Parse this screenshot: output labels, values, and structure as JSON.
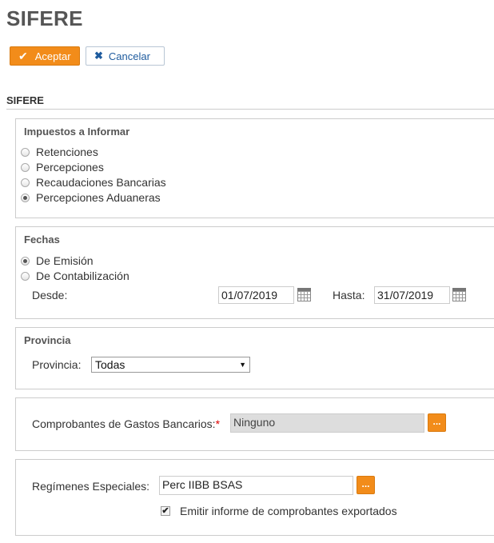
{
  "page": {
    "title": "SIFERE"
  },
  "toolbar": {
    "accept_label": "Aceptar",
    "cancel_label": "Cancelar"
  },
  "section": {
    "heading": "SIFERE"
  },
  "impuestos": {
    "title": "Impuestos a Informar",
    "options": [
      {
        "label": "Retenciones",
        "selected": false
      },
      {
        "label": "Percepciones",
        "selected": false
      },
      {
        "label": "Recaudaciones Bancarias",
        "selected": false
      },
      {
        "label": "Percepciones Aduaneras",
        "selected": true
      }
    ]
  },
  "fechas": {
    "title": "Fechas",
    "options": [
      {
        "label": "De Emisión",
        "selected": true
      },
      {
        "label": "De Contabilización",
        "selected": false
      }
    ],
    "desde_label": "Desde:",
    "desde_value": "01/07/2019",
    "hasta_label": "Hasta:",
    "hasta_value": "31/07/2019"
  },
  "provincia": {
    "title": "Provincia",
    "label": "Provincia:",
    "selected": "Todas"
  },
  "gastos": {
    "label": "Comprobantes de Gastos Bancarios:",
    "required_mark": "*",
    "value": "Ninguno",
    "button_label": "..."
  },
  "regimenes": {
    "label": "Regímenes Especiales:",
    "value": "Perc IIBB BSAS",
    "button_label": "...",
    "checkbox_label": "Emitir informe de comprobantes exportados",
    "checkbox_checked": true,
    "checkbox_mark": "✔"
  }
}
